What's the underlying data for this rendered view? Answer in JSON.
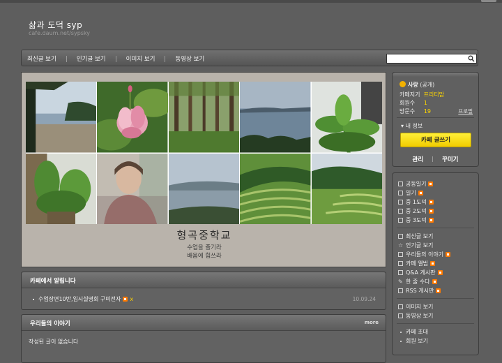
{
  "header": {
    "title": "삶과 도덕 syp",
    "url": "cafe.daum.net/sypsky"
  },
  "nav": {
    "items": [
      "최신글 보기",
      "인기글 보기",
      "이미지 보기",
      "동영상 보기"
    ],
    "search_placeholder": ""
  },
  "banner": {
    "school": "형곡중학교",
    "motto1": "수업을 즐기라",
    "motto2": "배움에 힘쓰라"
  },
  "notice": {
    "title": "카페에서 알립니다",
    "item": "수업장면10반,입시설명회 구미전자",
    "x_mark": "x",
    "date": "10.09.24"
  },
  "stories": {
    "title": "우리들의 이야기",
    "more": "more",
    "empty": "작성된 글이 없습니다"
  },
  "profile": {
    "level": "사랑",
    "visibility": "(공개)",
    "manager_label": "카페지기",
    "manager_value": "프리티맘",
    "members_label": "회원수",
    "members_value": "1",
    "visits_label": "방문수",
    "visits_value": "19",
    "profile_link": "프로필",
    "my_info": "내 정보",
    "write_button": "카페 글쓰기",
    "admin": "관리",
    "decorate": "꾸미기"
  },
  "menu": {
    "group1": [
      "공동일기",
      "일기",
      "중 1도덕",
      "중 2도덕",
      "중 3도덕"
    ],
    "group2": [
      "최신글 보기",
      "인기글 보기",
      "우리들의 이야기",
      "카페 앨범",
      "Q&A 게시판",
      "한 줄 수다",
      "RSS 게시판"
    ],
    "group3": [
      "이미지 보기",
      "동영상 보기"
    ],
    "group4": [
      "카페 초대",
      "회원 보기"
    ]
  },
  "colors": {
    "background": "#5e5e5e",
    "accent_yellow": "#ffd700",
    "button_yellow": "#f6e000",
    "new_badge": "#ff7a00"
  }
}
